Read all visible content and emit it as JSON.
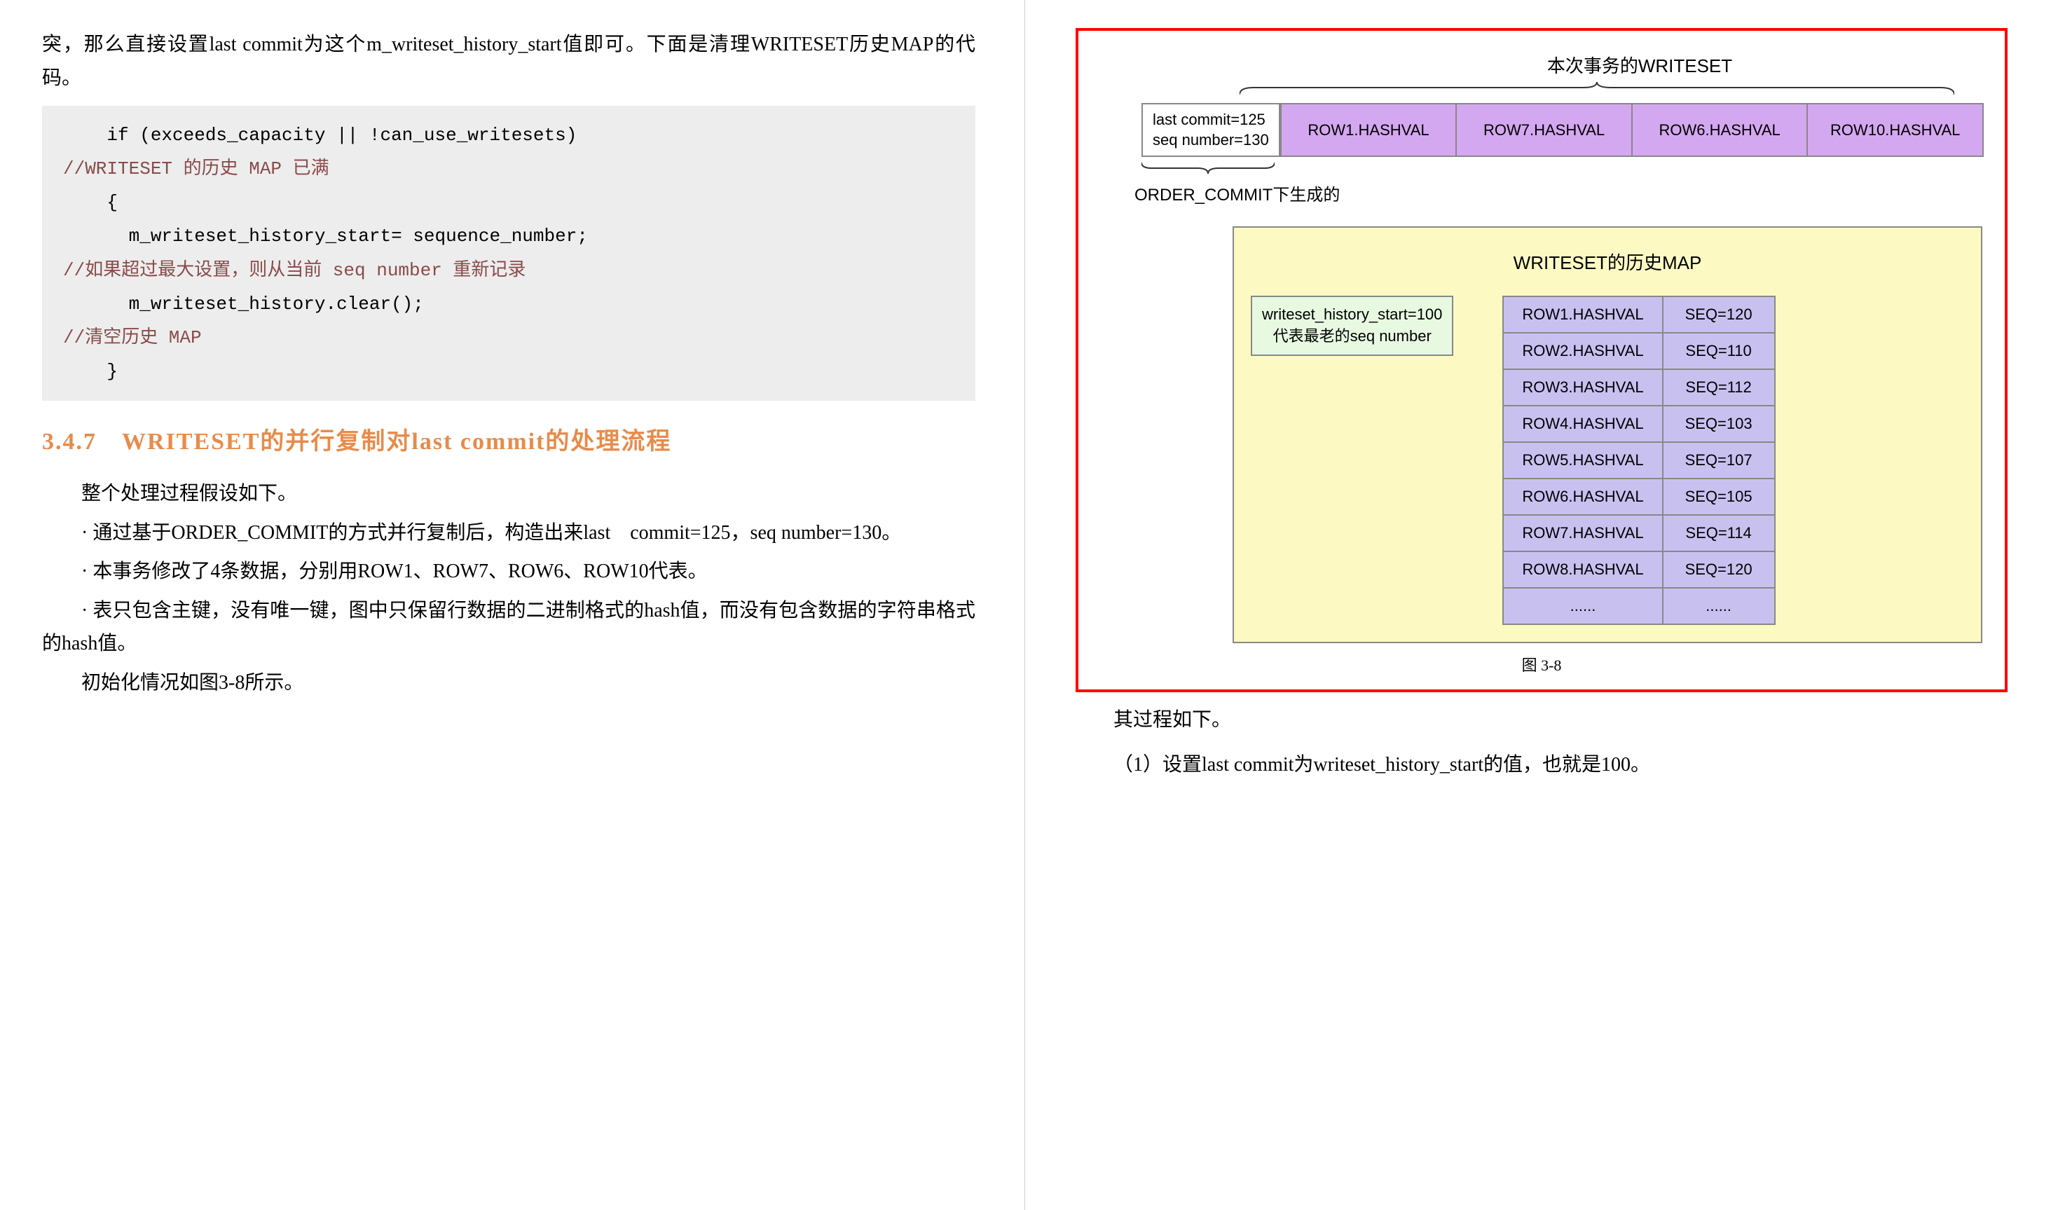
{
  "left": {
    "intro": "突，那么直接设置last commit为这个m_writeset_history_start值即可。下面是清理WRITESET历史MAP的代码。",
    "code": {
      "l1": "    if (exceeds_capacity || !can_use_writesets)",
      "c1": "//WRITESET 的历史 MAP 已满",
      "l2": "    {",
      "l3": "      m_writeset_history_start= sequence_number;",
      "c2": "//如果超过最大设置，则从当前 seq number 重新记录",
      "l4": "      m_writeset_history.clear();",
      "c3": "//清空历史 MAP",
      "l5": "    }"
    },
    "heading": "3.4.7　WRITESET的并行复制对last commit的处理流程",
    "p1": "整个处理过程假设如下。",
    "b1": "· 通过基于ORDER_COMMIT的方式并行复制后，构造出来last　commit=125，seq number=130。",
    "b2": "· 本事务修改了4条数据，分别用ROW1、ROW7、ROW6、ROW10代表。",
    "b3": "· 表只包含主键，没有唯一键，图中只保留行数据的二进制格式的hash值，而没有包含数据的字符串格式的hash值。",
    "p2": "初始化情况如图3-8所示。"
  },
  "chart_data": {
    "type": "table",
    "title_top": "本次事务的WRITESET",
    "commit_box": {
      "line1": "last commit=125",
      "line2": "seq number=130"
    },
    "hash_row": [
      "ROW1.HASHVAL",
      "ROW7.HASHVAL",
      "ROW6.HASHVAL",
      "ROW10.HASHVAL"
    ],
    "order_commit_label": "ORDER_COMMIT下生成的",
    "history_map": {
      "title": "WRITESET的历史MAP",
      "start_box": {
        "line1": "writeset_history_start=100",
        "line2": "代表最老的seq number"
      },
      "rows": [
        {
          "hash": "ROW1.HASHVAL",
          "seq": "SEQ=120"
        },
        {
          "hash": "ROW2.HASHVAL",
          "seq": "SEQ=110"
        },
        {
          "hash": "ROW3.HASHVAL",
          "seq": "SEQ=112"
        },
        {
          "hash": "ROW4.HASHVAL",
          "seq": "SEQ=103"
        },
        {
          "hash": "ROW5.HASHVAL",
          "seq": "SEQ=107"
        },
        {
          "hash": "ROW6.HASHVAL",
          "seq": "SEQ=105"
        },
        {
          "hash": "ROW7.HASHVAL",
          "seq": "SEQ=114"
        },
        {
          "hash": "ROW8.HASHVAL",
          "seq": "SEQ=120"
        },
        {
          "hash": "......",
          "seq": "......"
        }
      ]
    },
    "caption": "图 3-8"
  },
  "right": {
    "p1": "其过程如下。",
    "p2": "（1）设置last commit为writeset_history_start的值，也就是100。"
  }
}
